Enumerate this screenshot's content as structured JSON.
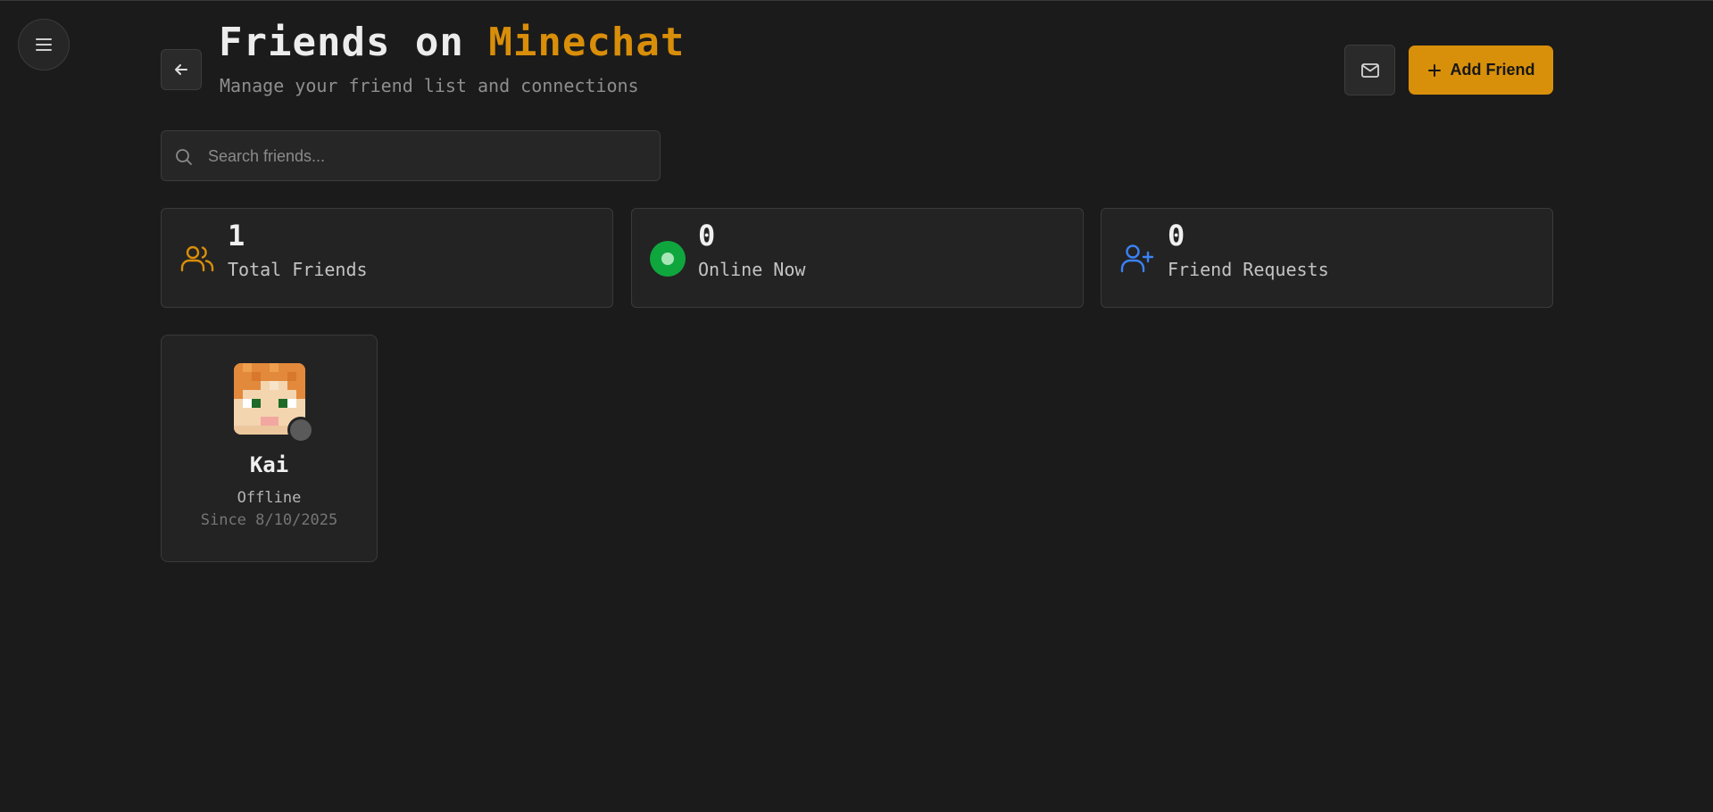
{
  "header": {
    "title_prefix": "Friends on ",
    "title_brand": "Minechat",
    "subtitle": "Manage your friend list and connections",
    "add_friend_label": "Add Friend"
  },
  "icons": {
    "menu": "menu-icon",
    "back": "arrow-left-icon",
    "mail": "mail-icon",
    "add": "plus-icon",
    "search": "search-icon",
    "total_friends": "users-icon",
    "online": "online-dot-icon",
    "requests": "user-plus-icon"
  },
  "search": {
    "placeholder": "Search friends...",
    "value": ""
  },
  "stats": [
    {
      "value": "1",
      "label": "Total Friends",
      "color": "#d98e0a"
    },
    {
      "value": "0",
      "label": "Online Now",
      "color": "#0fa63e"
    },
    {
      "value": "0",
      "label": "Friend Requests",
      "color": "#3b82f6"
    }
  ],
  "friends": [
    {
      "name": "Kai",
      "status": "Offline",
      "since": "Since 8/10/2025"
    }
  ],
  "colors": {
    "accent": "#d8900a",
    "background": "#1b1b1b",
    "card": "#232323",
    "offline": "#5a5a5a"
  }
}
